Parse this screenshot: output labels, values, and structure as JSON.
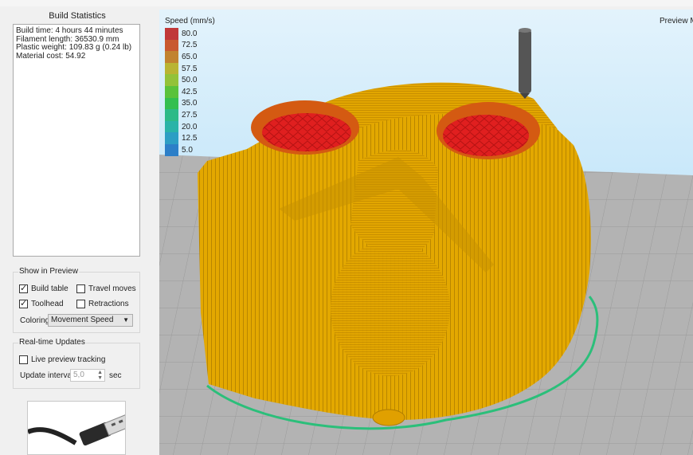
{
  "build_statistics": {
    "title": "Build Statistics",
    "lines": [
      "Build time: 4 hours 44 minutes",
      "Filament length: 36530.9 mm",
      "Plastic weight: 109.83 g (0.24 lb)",
      "Material cost: 54.92"
    ]
  },
  "show_in_preview": {
    "title": "Show in Preview",
    "build_table": {
      "label": "Build table",
      "checked": true
    },
    "travel_moves": {
      "label": "Travel moves",
      "checked": false
    },
    "toolhead": {
      "label": "Toolhead",
      "checked": true
    },
    "retractions": {
      "label": "Retractions",
      "checked": false
    },
    "coloring_label": "Coloring",
    "coloring_value": "Movement Speed"
  },
  "realtime_updates": {
    "title": "Real-time Updates",
    "live_preview": {
      "label": "Live preview tracking",
      "checked": false
    },
    "interval_label": "Update interval",
    "interval_value": "5,0",
    "interval_unit": "sec"
  },
  "viewport": {
    "legend_title": "Speed (mm/s)",
    "legend": [
      {
        "value": "80.0",
        "color": "#c0393a"
      },
      {
        "value": "72.5",
        "color": "#c85a30"
      },
      {
        "value": "65.0",
        "color": "#c1832f"
      },
      {
        "value": "57.5",
        "color": "#b9b433"
      },
      {
        "value": "50.0",
        "color": "#93c23a"
      },
      {
        "value": "42.5",
        "color": "#5ac23c"
      },
      {
        "value": "35.0",
        "color": "#33bf50"
      },
      {
        "value": "27.5",
        "color": "#2cba88"
      },
      {
        "value": "20.0",
        "color": "#29b3a8"
      },
      {
        "value": "12.5",
        "color": "#2c9ec4"
      },
      {
        "value": "5.0",
        "color": "#2c7fc8"
      }
    ],
    "mode_label": "Preview Mo"
  }
}
